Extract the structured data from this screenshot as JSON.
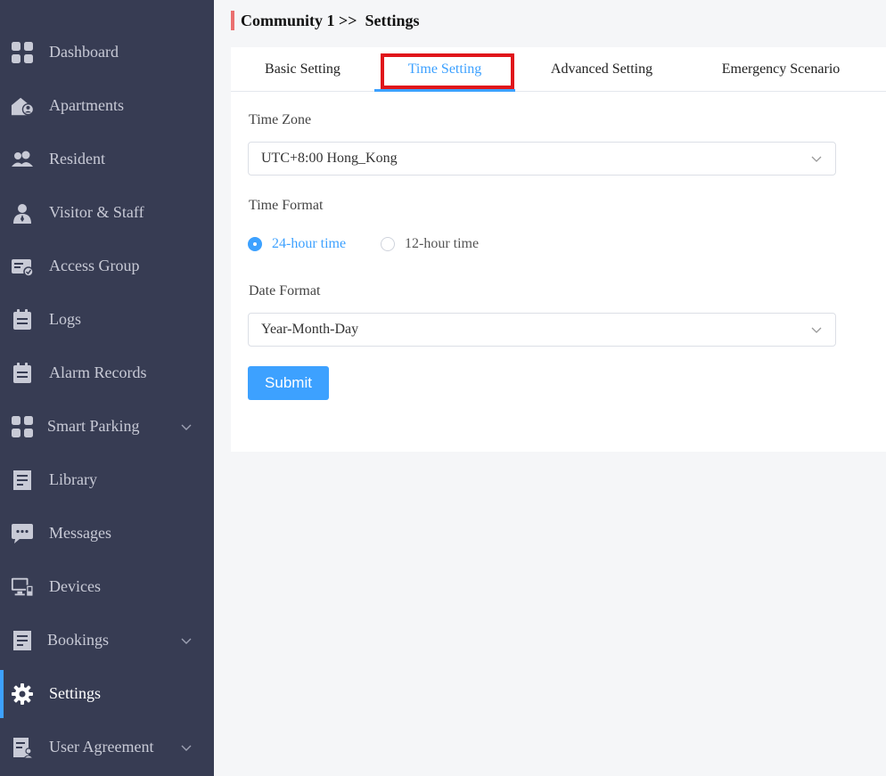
{
  "sidebar": {
    "items": [
      {
        "label": "Dashboard",
        "icon": "dashboard-icon"
      },
      {
        "label": "Apartments",
        "icon": "apartment-icon"
      },
      {
        "label": "Resident",
        "icon": "resident-icon"
      },
      {
        "label": "Visitor & Staff",
        "icon": "visitor-staff-icon"
      },
      {
        "label": "Access Group",
        "icon": "access-group-icon"
      },
      {
        "label": "Logs",
        "icon": "logs-icon"
      },
      {
        "label": "Alarm Records",
        "icon": "alarm-records-icon"
      },
      {
        "label": "Smart Parking",
        "icon": "smart-parking-icon",
        "expandable": true
      },
      {
        "label": "Library",
        "icon": "library-icon"
      },
      {
        "label": "Messages",
        "icon": "messages-icon"
      },
      {
        "label": "Devices",
        "icon": "devices-icon"
      },
      {
        "label": "Bookings",
        "icon": "bookings-icon",
        "expandable": true
      },
      {
        "label": "Settings",
        "icon": "gear-icon",
        "active": true
      },
      {
        "label": "User Agreement",
        "icon": "user-agreement-icon",
        "expandable": true
      }
    ]
  },
  "header": {
    "breadcrumb": "Community 1 >>  Settings"
  },
  "tabs": [
    {
      "label": "Basic Setting"
    },
    {
      "label": "Time Setting",
      "active": true
    },
    {
      "label": "Advanced Setting"
    },
    {
      "label": "Emergency Scenario"
    }
  ],
  "form": {
    "time_zone_label": "Time Zone",
    "time_zone_value": "UTC+8:00 Hong_Kong",
    "time_format_label": "Time Format",
    "time_format_options": [
      "24-hour time",
      "12-hour time"
    ],
    "time_format_selected": "24-hour time",
    "date_format_label": "Date Format",
    "date_format_value": "Year-Month-Day",
    "submit_label": "Submit"
  },
  "colors": {
    "sidebar_bg": "#373c53",
    "accent": "#3da1ff",
    "highlight": "#e0161b",
    "header_bar": "#ea6f6f"
  }
}
